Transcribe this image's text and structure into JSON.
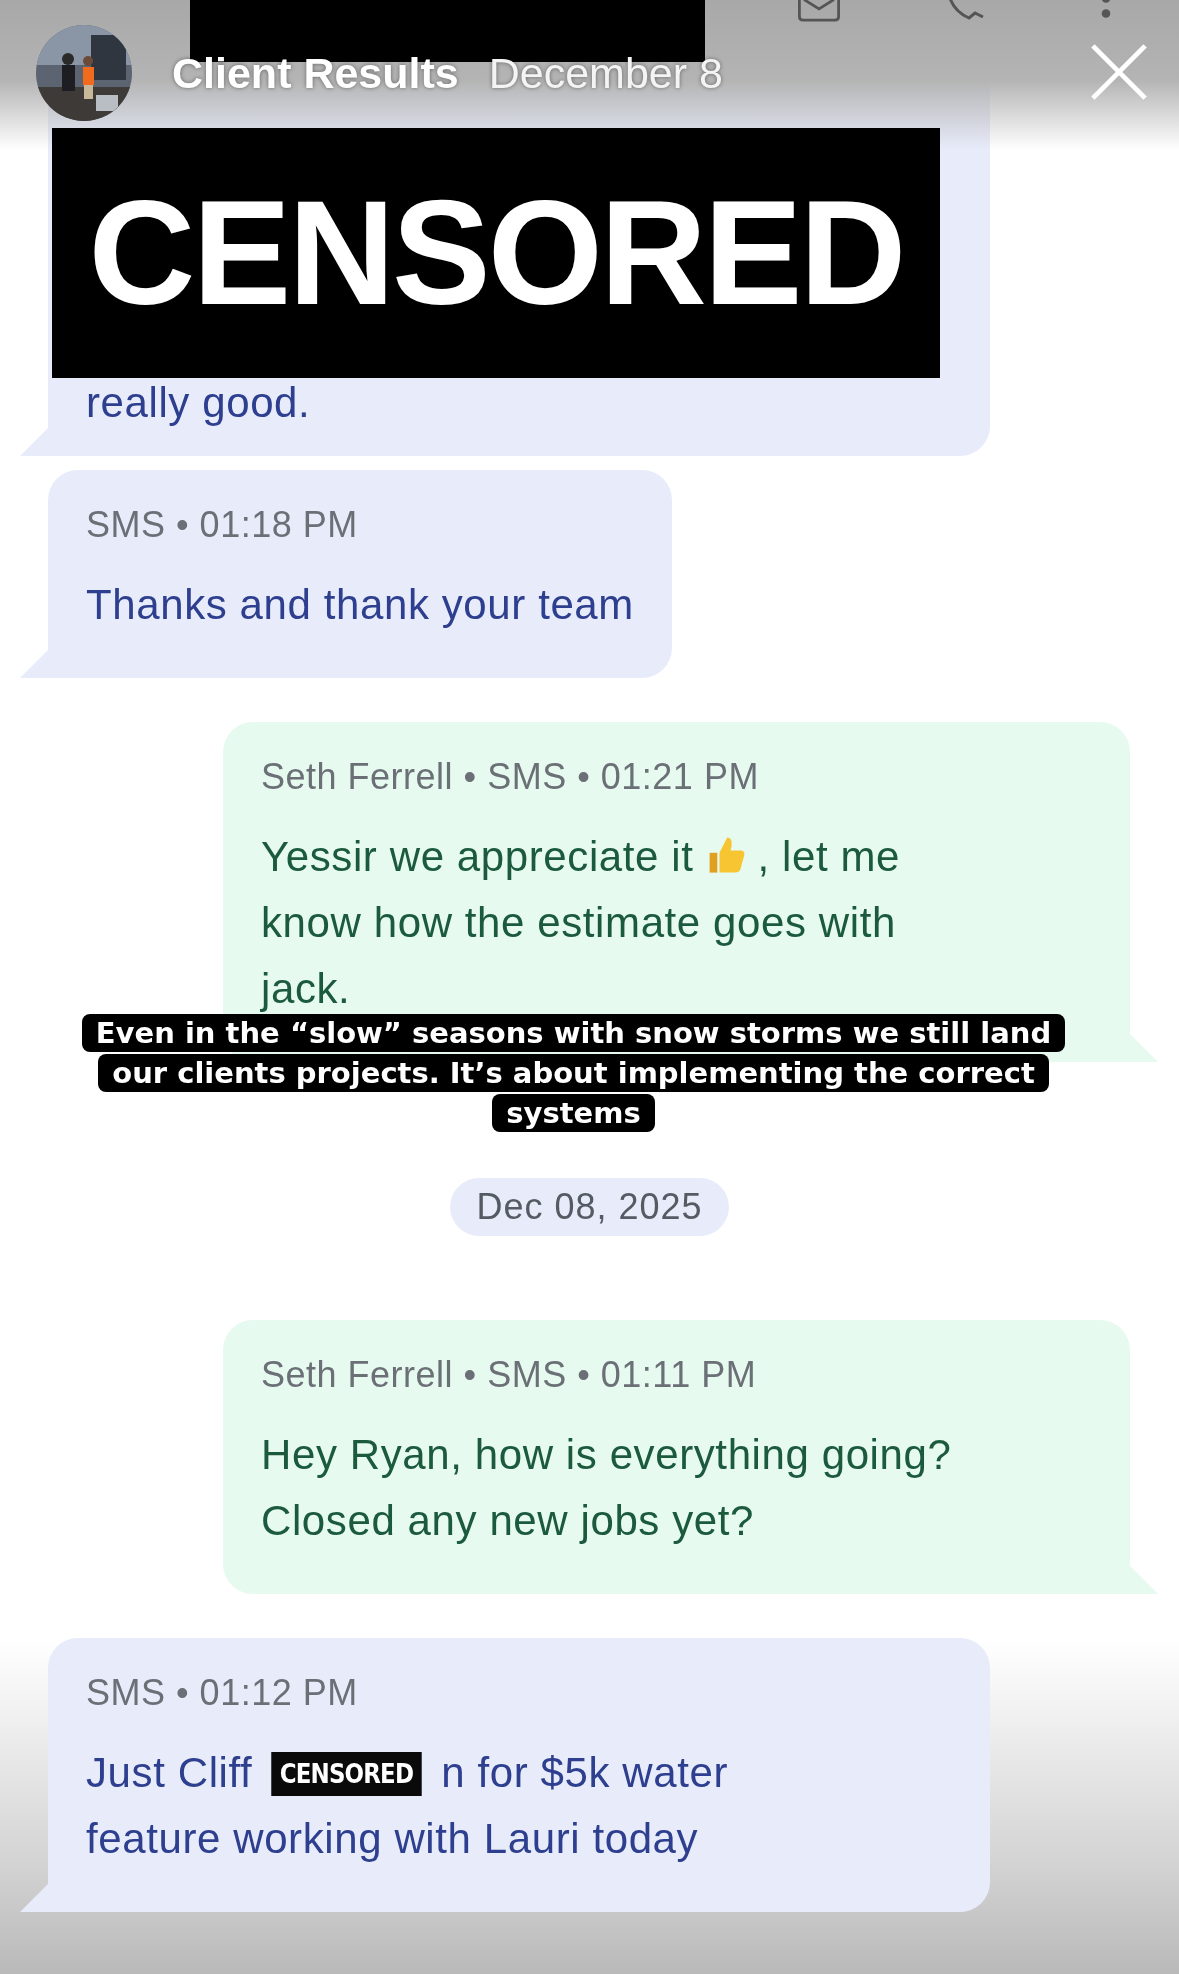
{
  "story": {
    "title": "Client Results",
    "date": "December 8",
    "sticker": "CENSORED"
  },
  "thread": [
    {
      "kind": "in",
      "parts": [
        {
          "kind": "text",
          "text": "really good."
        }
      ]
    },
    {
      "kind": "in",
      "meta": "SMS • 01:18 PM",
      "parts": [
        {
          "kind": "text",
          "text": "Thanks and thank your team"
        }
      ]
    },
    {
      "kind": "out",
      "meta": "Seth Ferrell • SMS • 01:21 PM",
      "parts": [
        {
          "kind": "text",
          "text": "Yessir we appreciate it"
        },
        {
          "kind": "emoji"
        },
        {
          "kind": "text",
          "text": ", let me"
        },
        {
          "kind": "break"
        },
        {
          "kind": "text",
          "text": "know how the estimate goes with"
        },
        {
          "kind": "break"
        },
        {
          "kind": "text",
          "text": "jack."
        }
      ]
    },
    {
      "kind": "date",
      "text": "Dec 08, 2025"
    },
    {
      "kind": "out",
      "meta": "Seth Ferrell • SMS • 01:11 PM",
      "parts": [
        {
          "kind": "text",
          "text": "Hey Ryan, how is everything going?"
        },
        {
          "kind": "break"
        },
        {
          "kind": "text",
          "text": "Closed any new jobs yet?"
        }
      ]
    },
    {
      "kind": "in",
      "meta": "SMS • 01:12 PM",
      "parts": [
        {
          "kind": "text",
          "text": "Just Cliff"
        },
        {
          "kind": "sticker",
          "text": "CENSORED"
        },
        {
          "kind": "text",
          "text": "n for $5k water"
        },
        {
          "kind": "break"
        },
        {
          "kind": "text",
          "text": "feature working with Lauri today"
        }
      ]
    }
  ],
  "caption": "Even in the “slow” seasons with snow storms we still land our clients projects. It’s about implementing the correct systems"
}
